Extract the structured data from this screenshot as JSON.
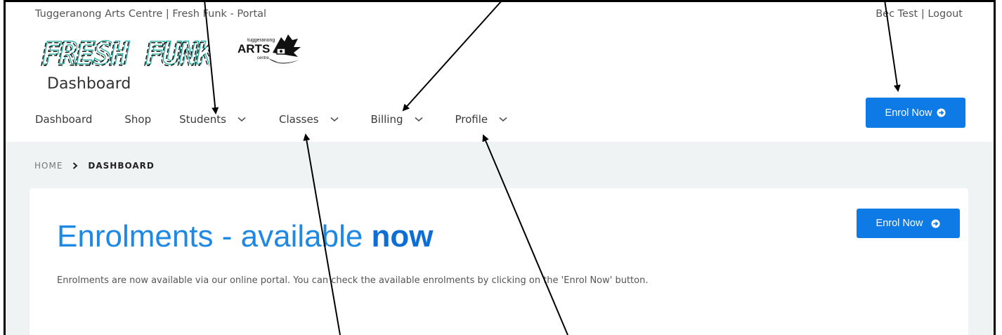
{
  "header": {
    "site_title": "Tuggeranong Arts Centre | Fresh Funk - Portal",
    "user_name": "Bec Test",
    "separator": " | ",
    "logout_label": "Logout",
    "page_heading": "Dashboard"
  },
  "logos": {
    "fresh_funk": "FRESH FUNK",
    "arts_centre_small": "tuggeranong",
    "arts_centre_main": "ARTS",
    "arts_centre_sub": "centre"
  },
  "nav": {
    "items": [
      {
        "label": "Dashboard",
        "has_dropdown": false
      },
      {
        "label": "Shop",
        "has_dropdown": false
      },
      {
        "label": "Students",
        "has_dropdown": true
      },
      {
        "label": "Classes",
        "has_dropdown": true
      },
      {
        "label": "Billing",
        "has_dropdown": true
      },
      {
        "label": "Profile",
        "has_dropdown": true
      }
    ],
    "enrol_button": "Enrol Now"
  },
  "breadcrumb": {
    "home": "HOME",
    "current": "DASHBOARD"
  },
  "card": {
    "title_part1": "Enrolments - available ",
    "title_part2": "now",
    "description": "Enrolments are now available via our online portal. You can check the available enrolments by clicking on the 'Enrol Now' button.",
    "enrol_button": "Enrol Now"
  },
  "colors": {
    "accent": "#0d7ae6",
    "title_blue": "#1e88e5",
    "page_bg": "#eff3f4"
  }
}
